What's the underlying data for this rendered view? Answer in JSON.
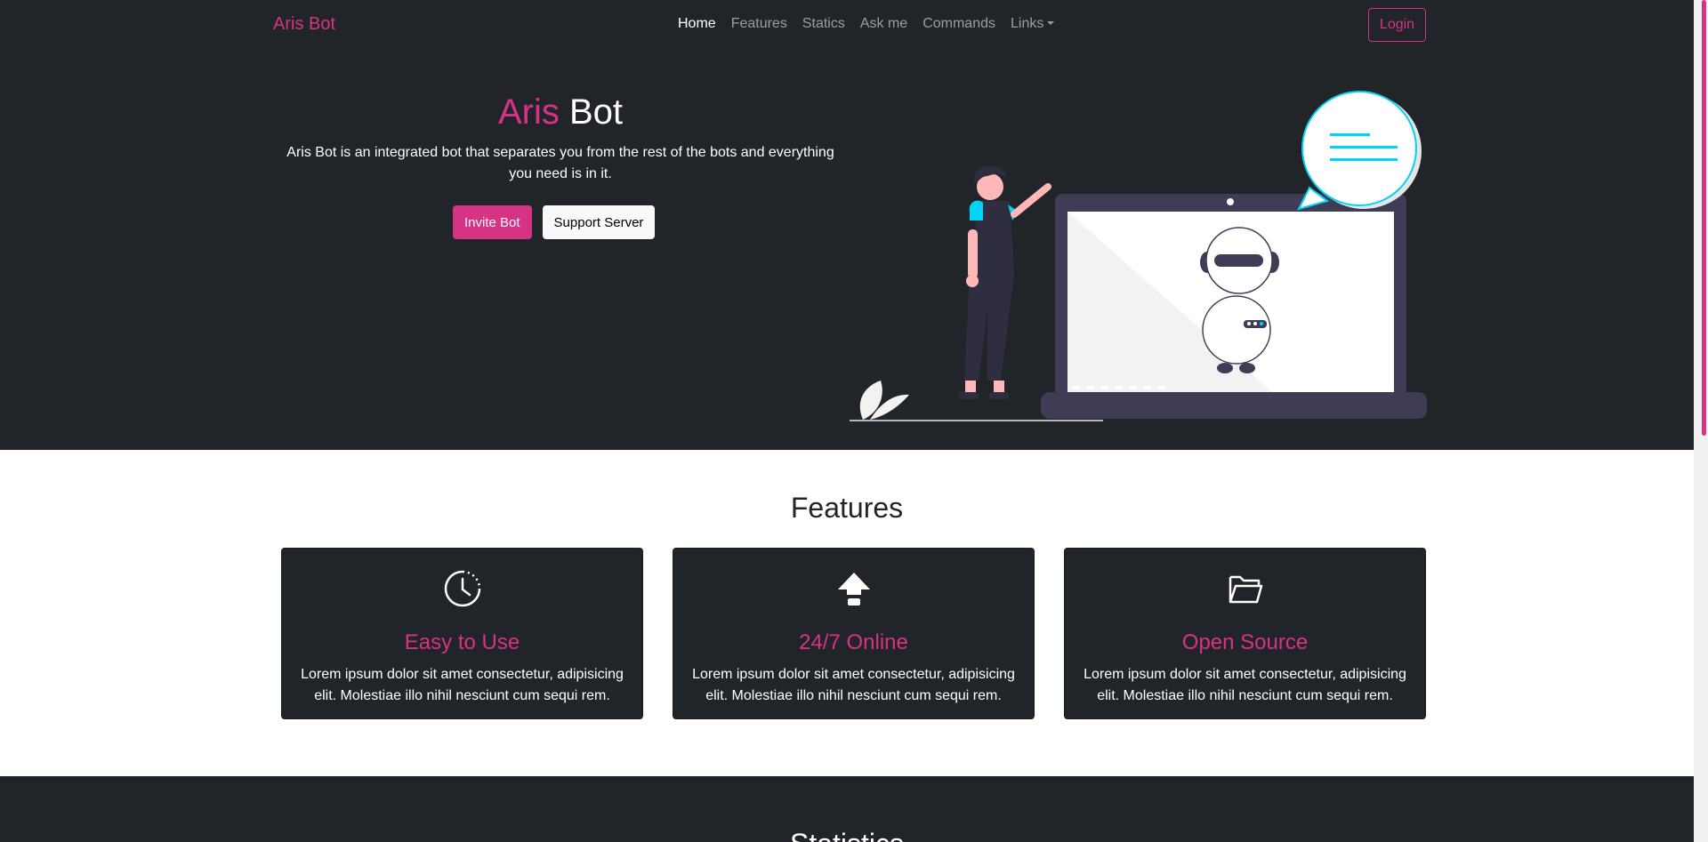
{
  "colors": {
    "accent": "#d63384",
    "dark": "#212529",
    "cyan": "#00d3f4"
  },
  "navbar": {
    "brand": "Aris Bot",
    "links": [
      {
        "label": "Home",
        "active": true
      },
      {
        "label": "Features"
      },
      {
        "label": "Statics"
      },
      {
        "label": "Ask me"
      },
      {
        "label": "Commands"
      },
      {
        "label": "Links"
      }
    ],
    "login_label": "Login"
  },
  "hero": {
    "title_accent": "Aris",
    "title_rest": "Bot",
    "description": "Aris Bot is an integrated bot that separates you from the rest of the bots and everything you need is in it.",
    "invite_label": "Invite Bot",
    "support_label": "Support Server"
  },
  "features": {
    "title": "Features",
    "cards": [
      {
        "icon": "clock-icon",
        "title": "Easy to Use",
        "text": "Lorem ipsum dolor sit amet consectetur, adipisicing elit. Molestiae illo nihil nesciunt cum sequi rem."
      },
      {
        "icon": "cloud-upload-icon",
        "title": "24/7 Online",
        "text": "Lorem ipsum dolor sit amet consectetur, adipisicing elit. Molestiae illo nihil nesciunt cum sequi rem."
      },
      {
        "icon": "folder-open-icon",
        "title": "Open Source",
        "text": "Lorem ipsum dolor sit amet consectetur, adipisicing elit. Molestiae illo nihil nesciunt cum sequi rem."
      }
    ]
  },
  "statistics": {
    "title": "Statistics"
  }
}
